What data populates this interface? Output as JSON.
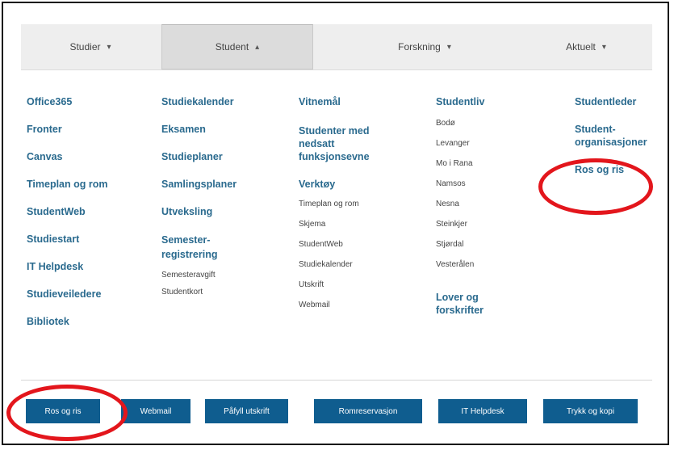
{
  "nav": {
    "items": [
      {
        "label": "Studier",
        "chevron": "▾",
        "active": false
      },
      {
        "label": "Student",
        "chevron": "▴",
        "active": true
      },
      {
        "label": "Forskning",
        "chevron": "▾",
        "active": false
      },
      {
        "label": "Aktuelt",
        "chevron": "▾",
        "active": false
      }
    ]
  },
  "col1": {
    "links": [
      "Office365",
      "Fronter",
      "Canvas",
      "Timeplan og rom",
      "StudentWeb",
      "Studiestart",
      "IT Helpdesk",
      "Studieveiledere",
      "Bibliotek"
    ]
  },
  "col2": {
    "links": [
      "Studiekalender",
      "Eksamen",
      "Studieplaner",
      "Samlingsplaner",
      "Utveksling",
      "Semester-\nregistrering"
    ],
    "sub": [
      "Semesteravgift",
      "Studentkort"
    ]
  },
  "col3": {
    "links": [
      "Vitnemål",
      "Studenter med\nnedsatt\nfunksjonsevne",
      "Verktøy"
    ],
    "sub": [
      "Timeplan og rom",
      "Skjema",
      "StudentWeb",
      "Studiekalender",
      "Utskrift",
      "Webmail"
    ]
  },
  "col4": {
    "heading": "Studentliv",
    "sub": [
      "Bodø",
      "Levanger",
      "Mo i Rana",
      "Namsos",
      "Nesna",
      "Steinkjer",
      "Stjørdal",
      "Vesterålen"
    ],
    "heading2": "Lover og\nforskrifter"
  },
  "col5": {
    "links": [
      "Studentleder",
      "Student-\norganisasjoner",
      "Ros og ris"
    ]
  },
  "buttons": [
    "Ros og ris",
    "Webmail",
    "Påfyll utskrift",
    "Romreservasjon",
    "IT Helpdesk",
    "Trykk og kopi"
  ],
  "annotation_color": "#e3161c"
}
